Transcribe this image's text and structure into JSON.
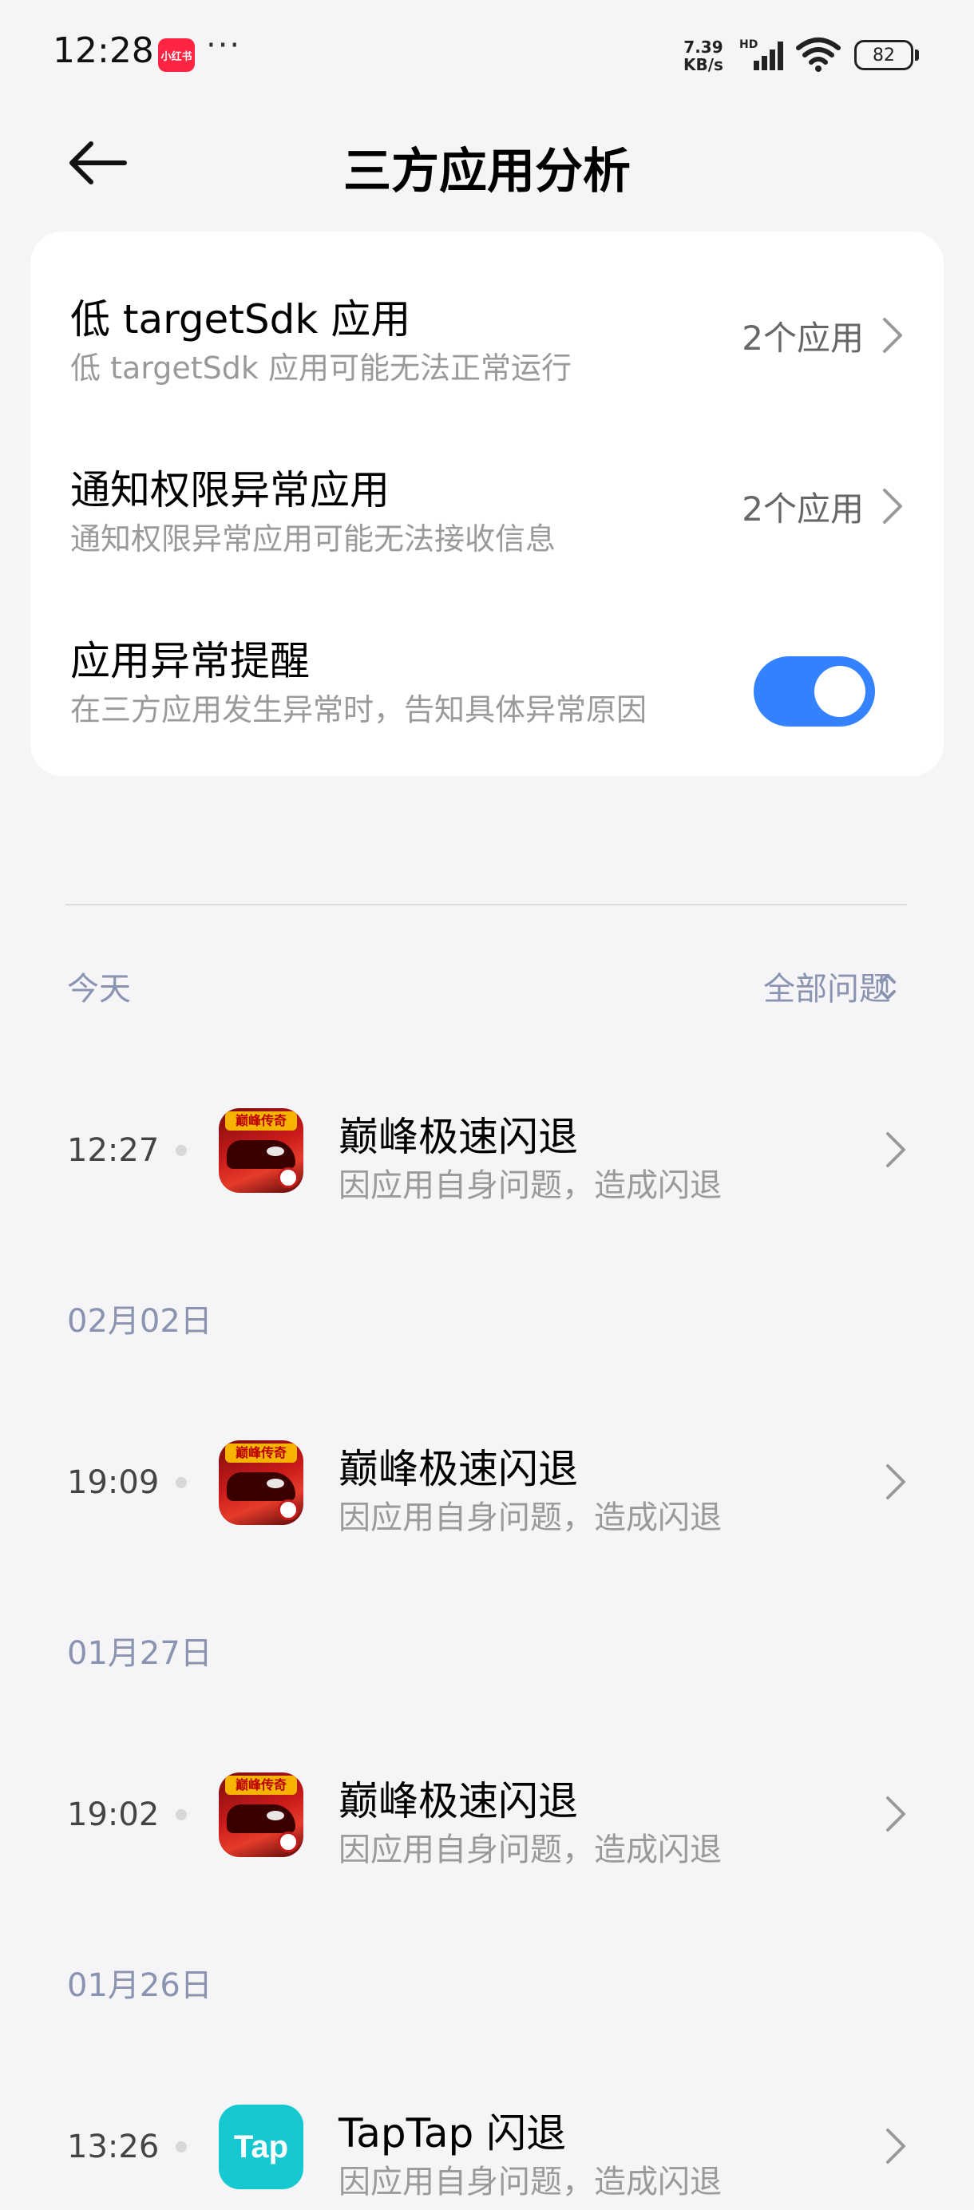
{
  "status_bar": {
    "time": "12:28",
    "notification_app": "小红书",
    "more": "···",
    "net_speed_value": "7.39",
    "net_speed_unit": "KB/s",
    "network_type": "HD",
    "battery": "82"
  },
  "header": {
    "title": "三方应用分析"
  },
  "settings": [
    {
      "title": "低 targetSdk 应用",
      "subtitle": "低 targetSdk 应用可能无法正常运行",
      "value": "2个应用"
    },
    {
      "title": "通知权限异常应用",
      "subtitle": "通知权限异常应用可能无法接收信息",
      "value": "2个应用"
    },
    {
      "title": "应用异常提醒",
      "subtitle": "在三方应用发生异常时，告知具体异常原因",
      "toggle_on": true
    }
  ],
  "filter": {
    "label": "全部问题"
  },
  "groups": [
    {
      "date": "今天",
      "items": [
        {
          "time": "12:27",
          "title": "巅峰极速闪退",
          "subtitle": "因应用自身问题，造成闪退",
          "icon": "game-icon"
        }
      ]
    },
    {
      "date": "02月02日",
      "items": [
        {
          "time": "19:09",
          "title": "巅峰极速闪退",
          "subtitle": "因应用自身问题，造成闪退",
          "icon": "game-icon"
        }
      ]
    },
    {
      "date": "01月27日",
      "items": [
        {
          "time": "19:02",
          "title": "巅峰极速闪退",
          "subtitle": "因应用自身问题，造成闪退",
          "icon": "game-icon"
        }
      ]
    },
    {
      "date": "01月26日",
      "items": [
        {
          "time": "13:26",
          "title": "TapTap 闪退",
          "subtitle": "因应用自身问题，造成闪退",
          "icon": "taptap-icon"
        }
      ]
    }
  ],
  "icons": {
    "game_banner": "巅峰传奇",
    "taptap_label": "Tap"
  },
  "colors": {
    "accent": "#3482ff",
    "background": "#f5f5f7",
    "secondary_text": "#9a9a9a",
    "date_text": "#8a93b0"
  }
}
